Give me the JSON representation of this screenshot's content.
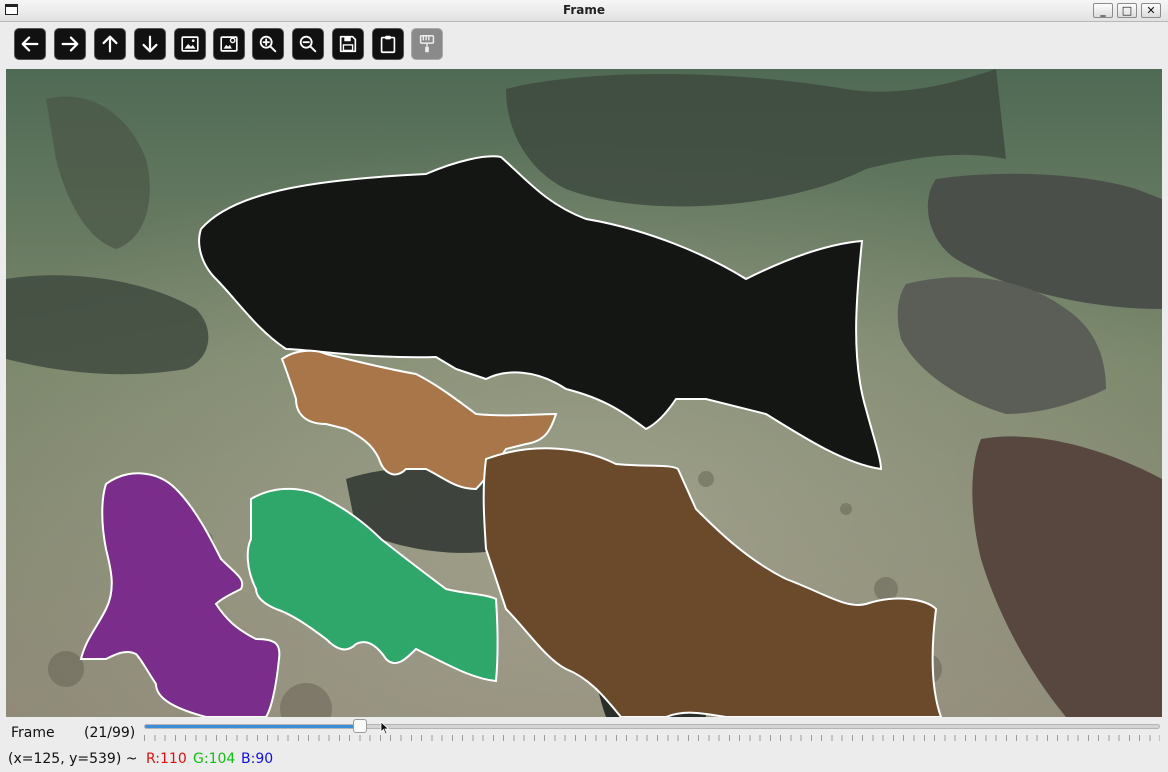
{
  "window": {
    "title": "Frame",
    "minimize_glyph": "_",
    "maximize_glyph": "□",
    "close_glyph": "✕"
  },
  "toolbar": {
    "buttons": [
      {
        "icon": "arrow-left-icon",
        "enabled": true
      },
      {
        "icon": "arrow-right-icon",
        "enabled": true
      },
      {
        "icon": "arrow-up-icon",
        "enabled": true
      },
      {
        "icon": "arrow-down-icon",
        "enabled": true
      },
      {
        "icon": "image-icon",
        "enabled": true
      },
      {
        "icon": "image-settings-icon",
        "enabled": true
      },
      {
        "icon": "zoom-in-icon",
        "enabled": true
      },
      {
        "icon": "zoom-out-icon",
        "enabled": true
      },
      {
        "icon": "save-icon",
        "enabled": true
      },
      {
        "icon": "clipboard-icon",
        "enabled": true
      },
      {
        "icon": "paint-brush-icon",
        "enabled": false
      }
    ]
  },
  "trackbar": {
    "label": "Frame",
    "count": "(21/99)",
    "value": 21,
    "max": 99
  },
  "status": {
    "coords": "(x=125, y=539) ~",
    "r": "R:110",
    "g": "G:104",
    "b": "B:90",
    "r_color": "#e01010",
    "g_color": "#10c010",
    "b_color": "#1010e0"
  },
  "segments": [
    {
      "name": "large-dark-fish",
      "color": "#141614"
    },
    {
      "name": "tan-fish",
      "color": "#a9764a"
    },
    {
      "name": "brown-fish",
      "color": "#6b4a2c"
    },
    {
      "name": "purple-fish",
      "color": "#7a2d8a"
    },
    {
      "name": "green-fish",
      "color": "#2fa66a"
    }
  ]
}
